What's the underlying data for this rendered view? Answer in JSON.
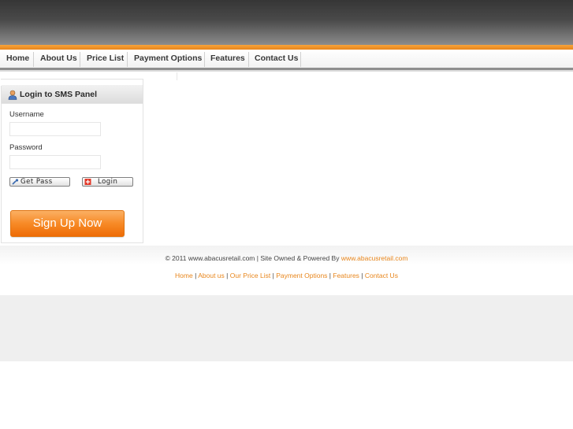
{
  "nav": {
    "items": [
      {
        "label": "Home"
      },
      {
        "label": "About Us"
      },
      {
        "label": "Price List"
      },
      {
        "label": "Payment Options"
      },
      {
        "label": "Features"
      },
      {
        "label": "Contact Us"
      }
    ]
  },
  "login": {
    "title": "Login to SMS Panel",
    "username_label": "Username",
    "username_value": "",
    "password_label": "Password",
    "password_value": "",
    "getpass_label": "Get Pass",
    "login_label": "Login",
    "signup_label": "Sign Up Now"
  },
  "footer": {
    "copyright_prefix": "© 2011 www.abacusretail.com | Site Owned & Powered By",
    "copyright_link": "www.abacusretail.com",
    "links": [
      {
        "label": "Home"
      },
      {
        "label": "About us"
      },
      {
        "label": "Our Price List"
      },
      {
        "label": "Payment Options"
      },
      {
        "label": "Features"
      },
      {
        "label": "Contact Us"
      }
    ],
    "separator": "|"
  },
  "colors": {
    "accent": "#e8861c",
    "header_dark": "#363636",
    "signup_orange": "#f78a26"
  }
}
